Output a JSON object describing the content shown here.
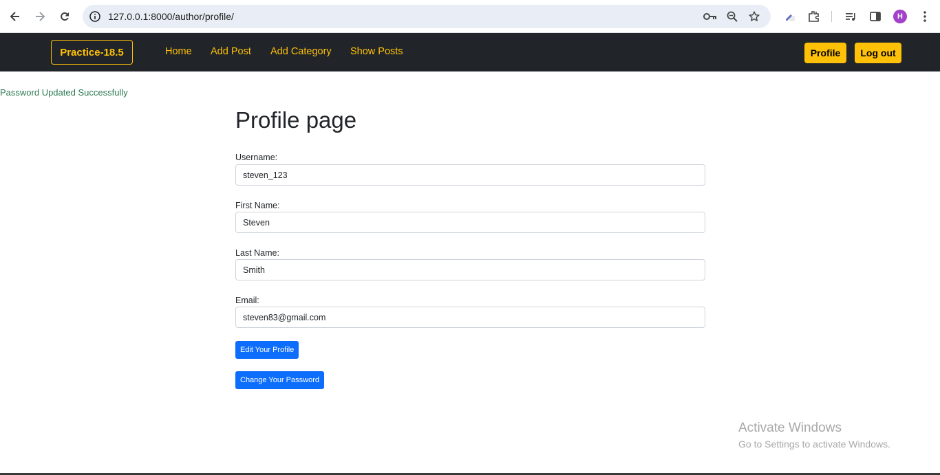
{
  "browser": {
    "url": "127.0.0.1:8000/author/profile/",
    "avatar_letter": "H",
    "avatar_color": "#a142c8"
  },
  "navbar": {
    "brand": "Practice-18.5",
    "links": [
      "Home",
      "Add Post",
      "Add Category",
      "Show Posts"
    ],
    "profile_btn": "Profile",
    "logout_btn": "Log out",
    "accent_color": "#ffc107",
    "bg_color": "#212529"
  },
  "alert": {
    "message": "Password Updated Successfully"
  },
  "profile": {
    "title": "Profile page",
    "fields": [
      {
        "label": "Username:",
        "value": "steven_123"
      },
      {
        "label": "First Name:",
        "value": "Steven"
      },
      {
        "label": "Last Name:",
        "value": "Smith"
      },
      {
        "label": "Email:",
        "value": "steven83@gmail.com"
      }
    ],
    "edit_btn": "Edit Your Profile",
    "password_btn": "Change Your Password"
  },
  "watermark": {
    "title": "Activate Windows",
    "subtitle": "Go to Settings to activate Windows."
  }
}
